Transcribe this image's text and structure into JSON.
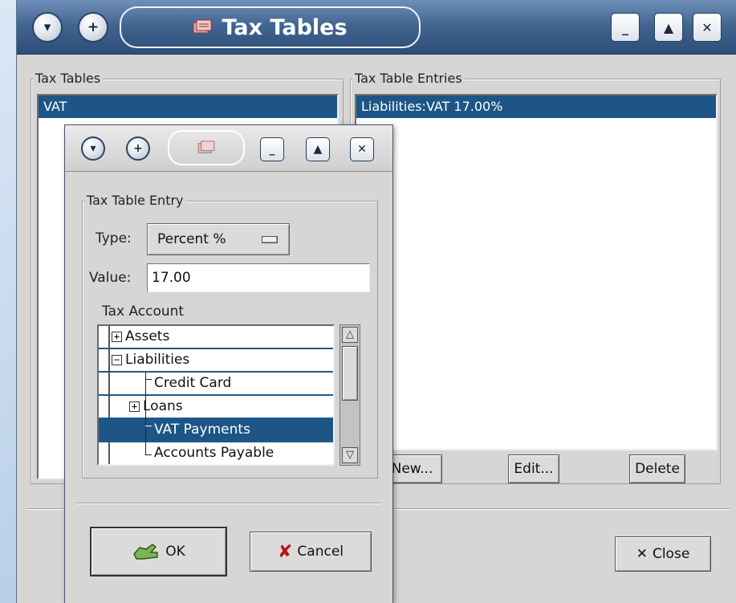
{
  "main_window": {
    "title": "Tax Tables",
    "title_icon": "tax-table-icon",
    "titlebar_buttons": {
      "menu": "▾",
      "shade": "+",
      "minimize": "_",
      "maximize": "▲",
      "close": "✕"
    },
    "tax_tables_group": {
      "label": "Tax Tables",
      "items": [
        "VAT"
      ],
      "selected_index": 0
    },
    "entries_group": {
      "label": "Tax Table Entries",
      "items": [
        "Liabilities:VAT  17.00%"
      ],
      "selected_index": 0
    },
    "buttons": {
      "new": "New...",
      "edit": "Edit...",
      "delete": "Delete",
      "close": "Close",
      "close_icon": "✕"
    }
  },
  "dialog": {
    "title": "",
    "title_icon": "tax-table-icon",
    "group_label": "Tax Table Entry",
    "type_label": "Type:",
    "type_value": "Percent %",
    "value_label": "Value:",
    "value": "17.00",
    "account_label": "Tax Account",
    "accounts": [
      {
        "label": "Assets",
        "level": 0,
        "expander": "+"
      },
      {
        "label": "Liabilities",
        "level": 0,
        "expander": "−"
      },
      {
        "label": "Credit Card",
        "level": 1,
        "expander": ""
      },
      {
        "label": "Loans",
        "level": 1,
        "expander": "+"
      },
      {
        "label": "VAT Payments",
        "level": 1,
        "expander": "",
        "selected": true
      },
      {
        "label": "Accounts Payable",
        "level": 1,
        "expander": ""
      }
    ],
    "scroll_up": "△",
    "scroll_down": "▽",
    "ok_label": "OK",
    "cancel_label": "Cancel",
    "cancel_icon": "✘"
  },
  "colors": {
    "selection": "#1d5686",
    "titlebar": "#41648f",
    "window_bg": "#d7d6d4"
  }
}
